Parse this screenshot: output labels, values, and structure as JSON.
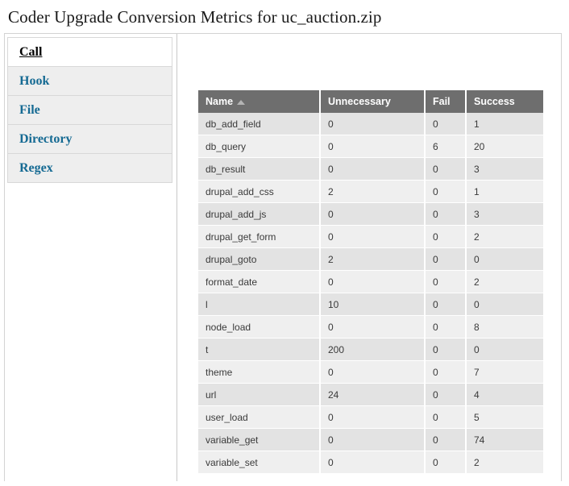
{
  "page": {
    "title": "Coder Upgrade Conversion Metrics for uc_auction.zip"
  },
  "sidebar": {
    "items": [
      {
        "label": "Call",
        "active": true
      },
      {
        "label": "Hook",
        "active": false
      },
      {
        "label": "File",
        "active": false
      },
      {
        "label": "Directory",
        "active": false
      },
      {
        "label": "Regex",
        "active": false
      }
    ]
  },
  "table": {
    "sort": {
      "column": "Name",
      "direction": "asc",
      "icon": "sort-ascending-icon"
    },
    "columns": [
      "Name",
      "Unnecessary",
      "Fail",
      "Success"
    ],
    "rows": [
      [
        "db_add_field",
        "0",
        "0",
        "1"
      ],
      [
        "db_query",
        "0",
        "6",
        "20"
      ],
      [
        "db_result",
        "0",
        "0",
        "3"
      ],
      [
        "drupal_add_css",
        "2",
        "0",
        "1"
      ],
      [
        "drupal_add_js",
        "0",
        "0",
        "3"
      ],
      [
        "drupal_get_form",
        "0",
        "0",
        "2"
      ],
      [
        "drupal_goto",
        "2",
        "0",
        "0"
      ],
      [
        "format_date",
        "0",
        "0",
        "2"
      ],
      [
        "l",
        "10",
        "0",
        "0"
      ],
      [
        "node_load",
        "0",
        "0",
        "8"
      ],
      [
        "t",
        "200",
        "0",
        "0"
      ],
      [
        "theme",
        "0",
        "0",
        "7"
      ],
      [
        "url",
        "24",
        "0",
        "4"
      ],
      [
        "user_load",
        "0",
        "0",
        "5"
      ],
      [
        "variable_get",
        "0",
        "0",
        "74"
      ],
      [
        "variable_set",
        "0",
        "0",
        "2"
      ]
    ]
  },
  "colors": {
    "link": "#156a93",
    "header_bg": "#6e6e6e",
    "row_odd": "#e3e3e3",
    "row_even": "#efefef",
    "border": "#d3d3d3"
  }
}
